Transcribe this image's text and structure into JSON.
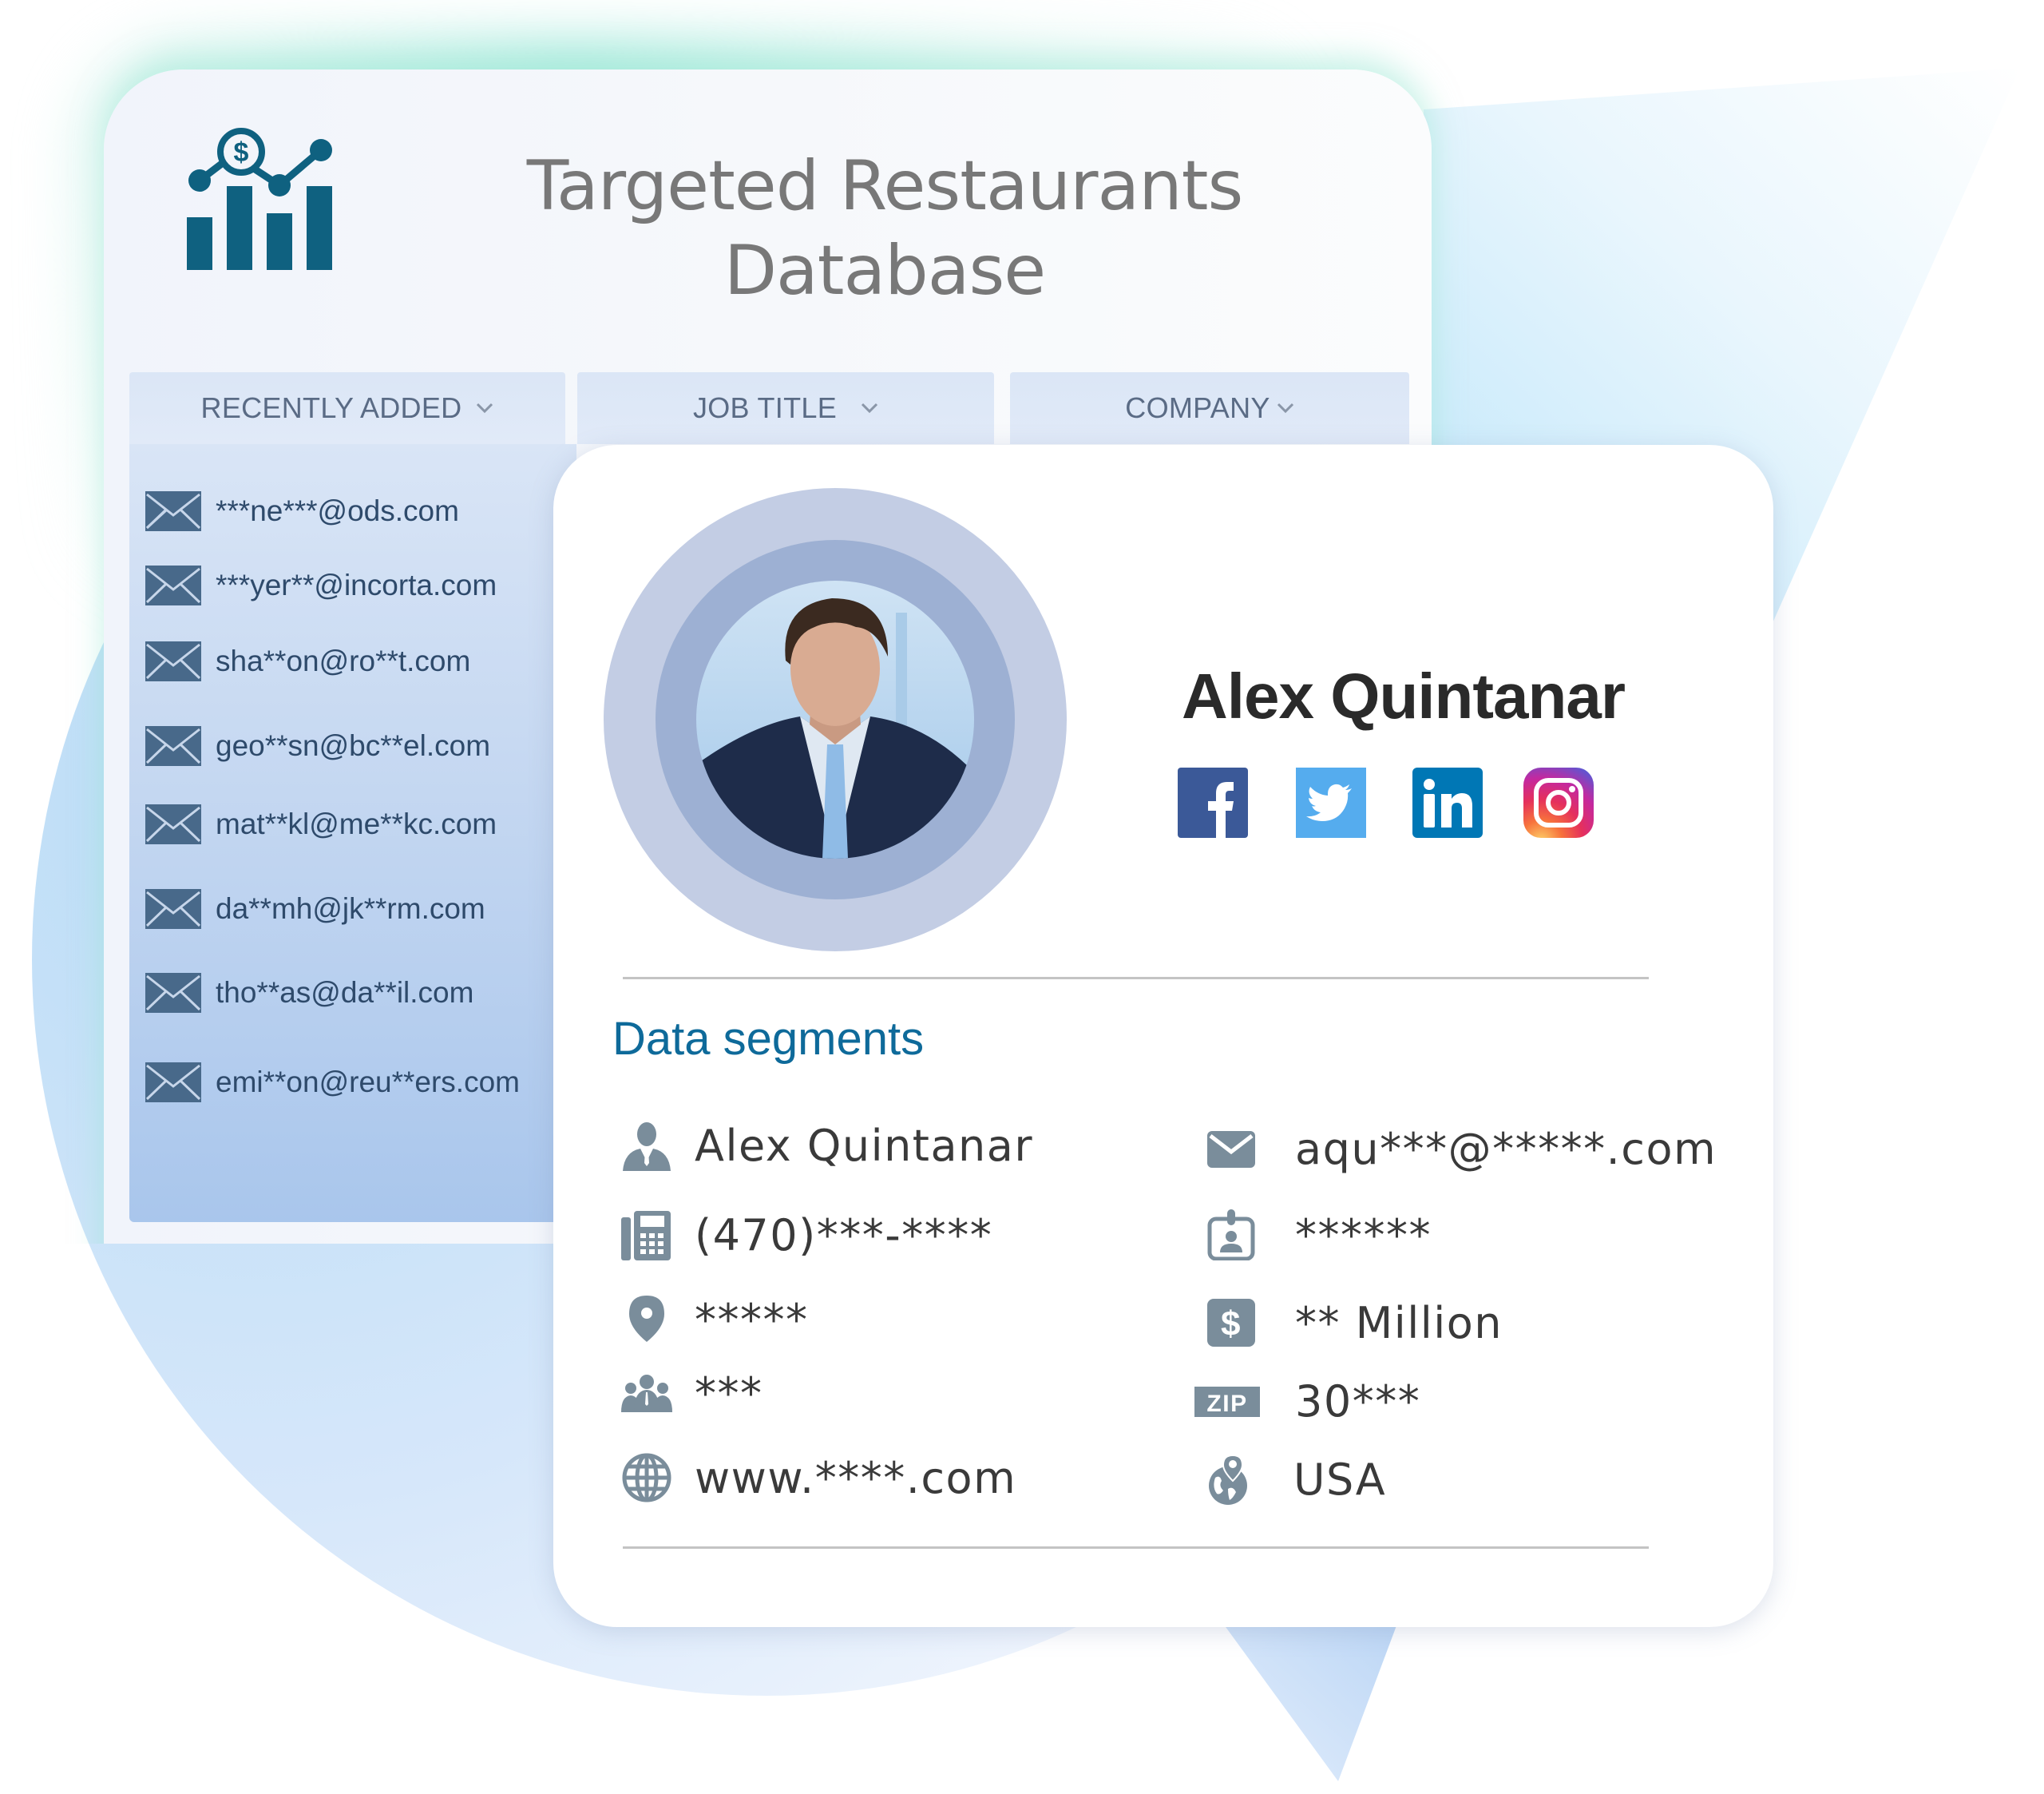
{
  "header": {
    "title_line1": "Targeted Restaurants",
    "title_line2": "Database",
    "logo_icon": "chart-dollar-icon"
  },
  "tabs": [
    {
      "label": "RECENTLY ADDED",
      "icon": "chevron-down-icon"
    },
    {
      "label": "JOB TITLE",
      "icon": "chevron-down-icon"
    },
    {
      "label": "COMPANY",
      "icon": "chevron-down-icon"
    }
  ],
  "email_list": [
    "***ne***@ods.com",
    "***yer**@incorta.com",
    "sha**on@ro**t.com",
    "geo**sn@bc**el.com",
    "mat**kl@me**kc.com",
    "da**mh@jk**rm.com",
    "tho**as@da**il.com",
    "emi**on@reu**ers.com"
  ],
  "profile": {
    "name": "Alex Quintanar",
    "social": [
      {
        "name": "Facebook",
        "icon": "facebook-icon",
        "color": "#3b5998"
      },
      {
        "name": "Twitter",
        "icon": "twitter-icon",
        "color": "#55acee"
      },
      {
        "name": "LinkedIn",
        "icon": "linkedin-icon",
        "color": "#0077b5"
      },
      {
        "name": "Instagram",
        "icon": "instagram-icon",
        "color": "#d6249f"
      }
    ]
  },
  "segments": {
    "title": "Data segments",
    "left": [
      {
        "icon": "person-icon",
        "value": "Alex Quintanar"
      },
      {
        "icon": "phone-icon",
        "value": "(470)***-****"
      },
      {
        "icon": "location-pin-icon",
        "value": "*****"
      },
      {
        "icon": "group-icon",
        "value": "***"
      },
      {
        "icon": "globe-icon",
        "value": "www.****.com"
      }
    ],
    "right": [
      {
        "icon": "envelope-icon",
        "value": "aqu***@*****.com"
      },
      {
        "icon": "id-badge-icon",
        "value": "******"
      },
      {
        "icon": "dollar-icon",
        "value": "** Million"
      },
      {
        "icon": "zip-icon",
        "value": "30***",
        "icon_text": "ZIP"
      },
      {
        "icon": "globe-pin-icon",
        "value": "USA"
      }
    ]
  },
  "colors": {
    "accent": "#0e6a9a",
    "logo": "#0f6180",
    "icon_gray": "#7a8d9b",
    "envelope": "#48698a"
  }
}
